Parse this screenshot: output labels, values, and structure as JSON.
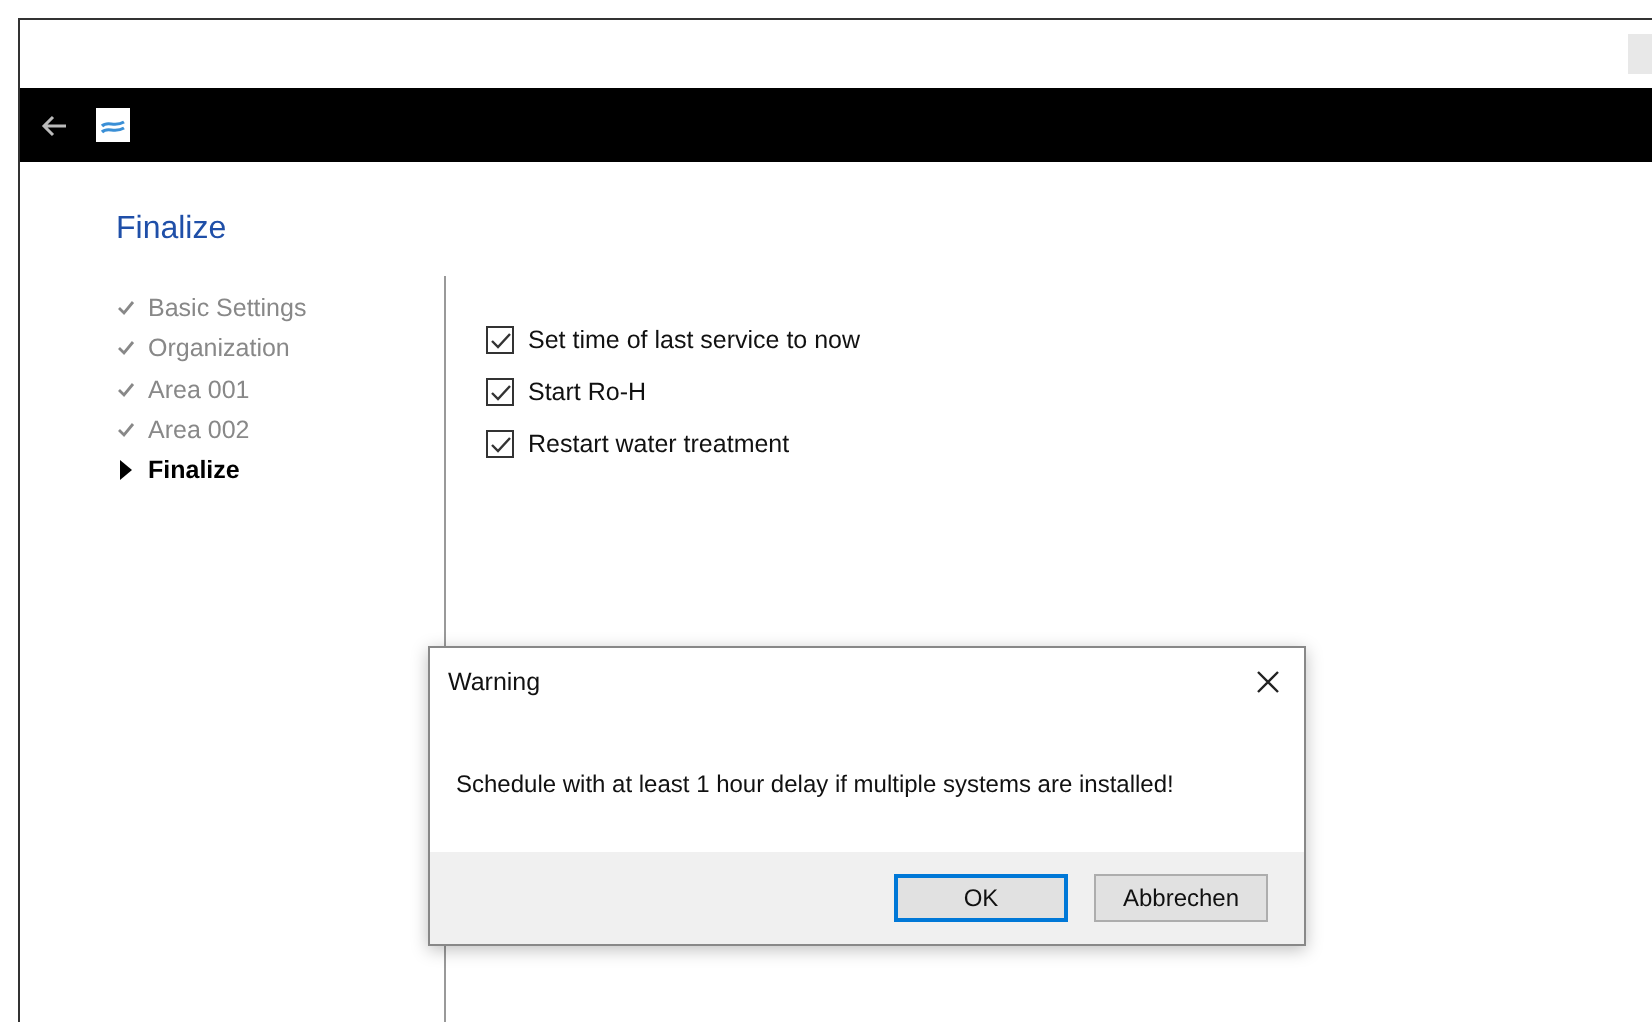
{
  "page": {
    "title": "Finalize"
  },
  "steps": [
    {
      "label": "Basic Settings",
      "selected": false
    },
    {
      "label": "Organization",
      "selected": false
    },
    {
      "label": "Area 001",
      "selected": false
    },
    {
      "label": "Area 002",
      "selected": false
    },
    {
      "label": "Finalize",
      "selected": true
    }
  ],
  "options": [
    {
      "label": "Set time of last service to now",
      "checked": true
    },
    {
      "label": "Start Ro-H",
      "checked": true
    },
    {
      "label": "Restart water treatment",
      "checked": true
    }
  ],
  "dialog": {
    "title": "Warning",
    "message": "Schedule with at least 1 hour delay if multiple systems are installed!",
    "buttons": [
      {
        "label": "OK",
        "default": true
      },
      {
        "label": "Abbrechen",
        "default": false
      }
    ]
  }
}
